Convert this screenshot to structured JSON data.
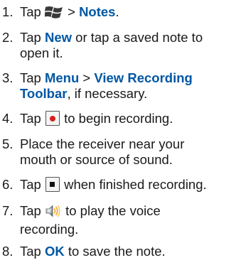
{
  "steps": [
    {
      "num": "1.",
      "pre": "Tap ",
      "icon": "windows-start-icon",
      "mid": " > ",
      "kw1": "Notes",
      "post": "."
    },
    {
      "num": "2.",
      "pre": "Tap ",
      "kw1": "New",
      "line1_rest": " or tap a saved note to",
      "line2": "open it."
    },
    {
      "num": "3.",
      "pre": "Tap ",
      "kw1": "Menu",
      "mid": " > ",
      "kw2": "View Recording",
      "kw3": "Toolbar",
      "post": ", if necessary."
    },
    {
      "num": "4.",
      "pre": "Tap ",
      "icon": "record-button-icon",
      "post": " to begin recording."
    },
    {
      "num": "5.",
      "line1": "Place the receiver near your",
      "line2": "mouth or source of sound."
    },
    {
      "num": "6.",
      "pre": "Tap ",
      "icon": "stop-button-icon",
      "post": " when finished recording."
    },
    {
      "num": "7.",
      "pre": "Tap ",
      "icon": "speaker-icon",
      "post": " to play the voice",
      "line2": "recording."
    },
    {
      "num": "8.",
      "pre": "Tap ",
      "kw1": "OK",
      "post": " to save the note."
    }
  ],
  "colors": {
    "keyword": "#0057a4",
    "text": "#1a1a1a",
    "record": "#d8201c"
  }
}
